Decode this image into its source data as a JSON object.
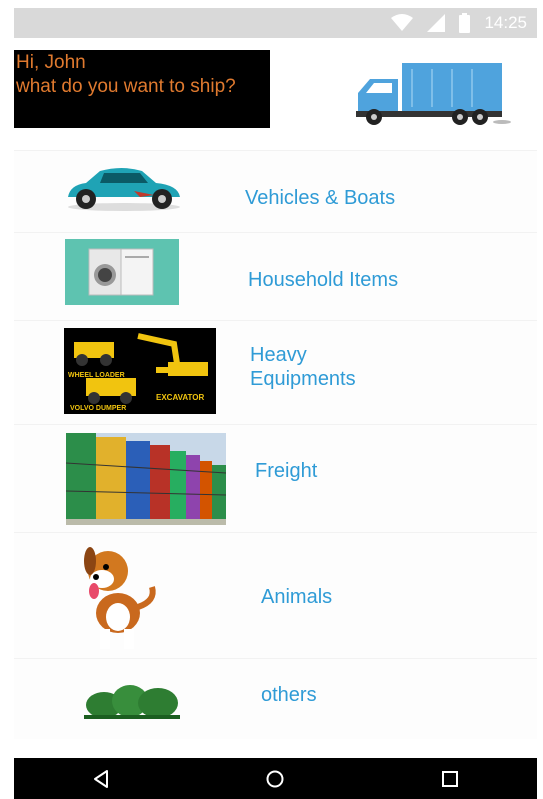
{
  "status_bar": {
    "time": "14:25",
    "icons": [
      "wifi-icon",
      "signal-icon",
      "battery-icon"
    ]
  },
  "greeting": {
    "line1": "Hi, John",
    "line2": "what do you want to ship?"
  },
  "categories": [
    {
      "label": "Vehicles & Boats",
      "icon": "car-icon"
    },
    {
      "label": "Household Items",
      "icon": "appliances-icon"
    },
    {
      "label": "Heavy Equipments",
      "line1": "Heavy",
      "line2": "Equipments",
      "icon": "heavy-machinery-icon",
      "image_text": [
        "WHEEL LOADER",
        "EXCAVATOR",
        "VOLVO DUMPER"
      ]
    },
    {
      "label": "Freight",
      "icon": "containers-icon"
    },
    {
      "label": "Animals",
      "icon": "dog-icon"
    },
    {
      "label": "others",
      "icon": "bushes-icon"
    }
  ],
  "nav_bar": {
    "icons": [
      "back-icon",
      "home-icon",
      "recents-icon"
    ]
  },
  "colors": {
    "accent_blue": "#2f9bd6",
    "greeting_orange": "#e07a2f",
    "truck_blue": "#4fa3dd"
  }
}
